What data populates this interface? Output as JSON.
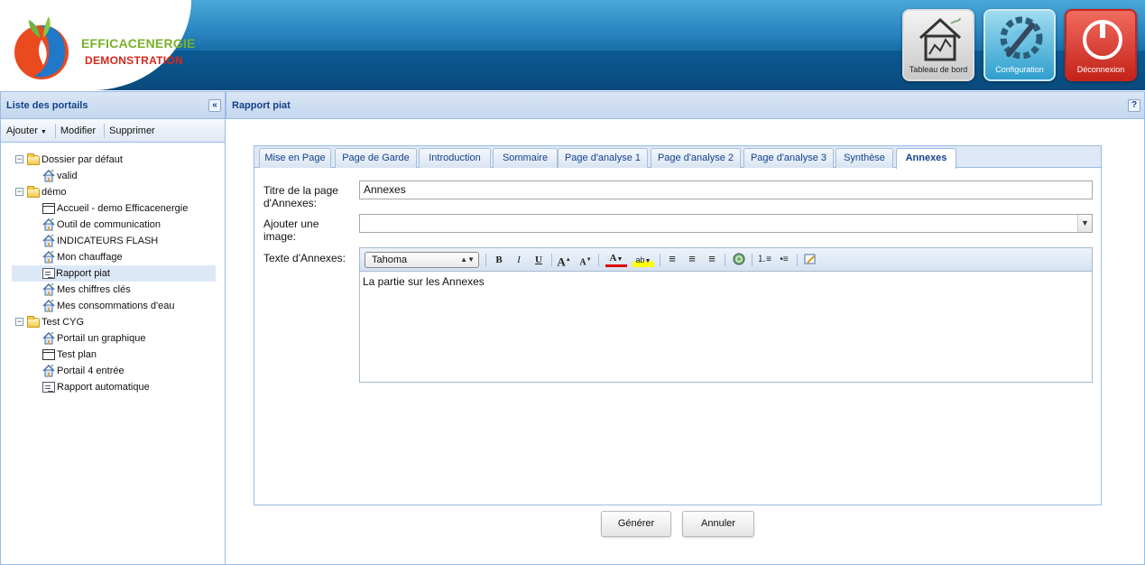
{
  "logo": {
    "line1": "EFFICACENERGIE",
    "line2": "DEMONSTRATION"
  },
  "header_buttons": {
    "tableau": "Tableau de  bord",
    "config": "Configuration",
    "deconnexion": "Déconnexion"
  },
  "left_panel": {
    "title": "Liste des portails",
    "collapse": "«",
    "toolbar": {
      "add": "Ajouter",
      "modify": "Modifier",
      "delete": "Supprimer"
    },
    "tree": [
      {
        "label": "Dossier par défaut",
        "type": "folder",
        "level": 0
      },
      {
        "label": "valid",
        "type": "house",
        "level": 1
      },
      {
        "label": "démo",
        "type": "folder",
        "level": 0
      },
      {
        "label": "Accueil - demo Efficacenergie",
        "type": "page",
        "level": 1
      },
      {
        "label": "Outil de communication",
        "type": "house",
        "level": 1
      },
      {
        "label": "INDICATEURS FLASH",
        "type": "house",
        "level": 1
      },
      {
        "label": "Mon chauffage",
        "type": "house",
        "level": 1
      },
      {
        "label": "Rapport piat",
        "type": "report",
        "level": 1,
        "selected": true
      },
      {
        "label": "Mes chiffres clés",
        "type": "house",
        "level": 1
      },
      {
        "label": "Mes consommations d'eau",
        "type": "house",
        "level": 1
      },
      {
        "label": "Test CYG",
        "type": "folder",
        "level": 0
      },
      {
        "label": "Portail un graphique",
        "type": "house",
        "level": 1
      },
      {
        "label": "Test plan",
        "type": "page",
        "level": 1
      },
      {
        "label": "Portail 4 entrée",
        "type": "house",
        "level": 1
      },
      {
        "label": "Rapport automatique",
        "type": "report",
        "level": 1
      }
    ]
  },
  "right_panel": {
    "title": "Rapport piat",
    "help": "?",
    "tabs": [
      "Mise en Page",
      "Page de Garde",
      "Introduction",
      "Sommaire",
      "Page d'analyse 1",
      "Page d'analyse 2",
      "Page d'analyse 3",
      "Synthèse",
      "Annexes"
    ],
    "active_tab": "Annexes",
    "form": {
      "title_label": "Titre de la page d'Annexes:",
      "title_value": "Annexes",
      "image_label": "Ajouter une image:",
      "image_value": "",
      "text_label": "Texte d'Annexes:",
      "font": "Tahoma",
      "text_value": "La partie sur les Annexes"
    },
    "buttons": {
      "generate": "Générer",
      "cancel": "Annuler"
    }
  },
  "colors": {
    "accent": "#15428b",
    "border": "#99bbe8",
    "header_blue": "#0a4a7c"
  }
}
